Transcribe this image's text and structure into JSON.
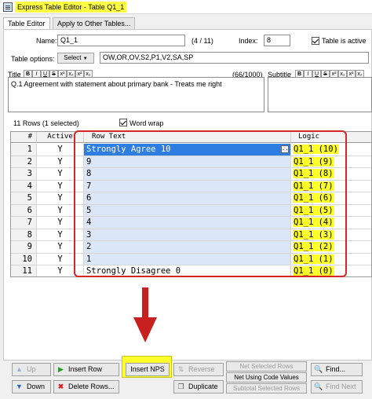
{
  "window": {
    "title": "Express Table Editor - Table Q1_1"
  },
  "tabs": [
    {
      "label": "Table Editor"
    },
    {
      "label": "Apply to Other Tables..."
    }
  ],
  "form": {
    "name_label": "Name:",
    "name_value": "Q1_1",
    "position": "(4 / 11)",
    "index_label": "Index:",
    "index_value": "8",
    "active_label": "Table is active",
    "table_options_label": "Table options:",
    "select_label": "Select",
    "options_value": "OW,OR,OV,S2,P1,V2,SA,SP",
    "title_label": "Title",
    "title_count": "(66/1000)",
    "subtitle_label": "Subtitle",
    "title_text": "Q.1  Agreement with statement about primary bank - Treats me right",
    "format_buttons": [
      "B",
      "I",
      "U",
      "S",
      "x²",
      "x₂",
      "x²",
      "x₂"
    ]
  },
  "rows_info": {
    "count_text": "11 Rows  (1 selected)",
    "wordwrap_label": "Word wrap"
  },
  "grid": {
    "headers": {
      "num": "#",
      "active": "Active",
      "text": "Row Text",
      "logic": "Logic"
    },
    "rows": [
      {
        "num": "1",
        "active": "Y",
        "text": "Strongly Agree 10",
        "logic": "Q1_1 (10)"
      },
      {
        "num": "2",
        "active": "Y",
        "text": "9",
        "logic": "Q1_1 (9)"
      },
      {
        "num": "3",
        "active": "Y",
        "text": "8",
        "logic": "Q1_1 (8)"
      },
      {
        "num": "4",
        "active": "Y",
        "text": "7",
        "logic": "Q1_1 (7)"
      },
      {
        "num": "5",
        "active": "Y",
        "text": "6",
        "logic": "Q1_1 (6)"
      },
      {
        "num": "6",
        "active": "Y",
        "text": "5",
        "logic": "Q1_1 (5)"
      },
      {
        "num": "7",
        "active": "Y",
        "text": "4",
        "logic": "Q1_1 (4)"
      },
      {
        "num": "8",
        "active": "Y",
        "text": "3",
        "logic": "Q1_1 (3)"
      },
      {
        "num": "9",
        "active": "Y",
        "text": "2",
        "logic": "Q1_1 (2)"
      },
      {
        "num": "10",
        "active": "Y",
        "text": "1",
        "logic": "Q1_1 (1)"
      },
      {
        "num": "11",
        "active": "Y",
        "text": "Strongly Disagree 0",
        "logic": "Q1_1 (0)"
      }
    ]
  },
  "buttons": {
    "up": "Up",
    "down": "Down",
    "insert_row": "Insert Row",
    "delete_rows": "Delete Rows...",
    "insert_nps": "Insert NPS",
    "reverse": "Reverse",
    "duplicate": "Duplicate",
    "net_selected": "Net Selected Rows",
    "net_code_values": "Net Using Code Values",
    "subtotal_selected": "Subtotal Selected Rows",
    "find": "Find...",
    "find_next": "Find Next"
  },
  "colors": {
    "highlight": "#ffff2a",
    "selection": "#2d7ee0",
    "annotation": "#d6262a"
  }
}
